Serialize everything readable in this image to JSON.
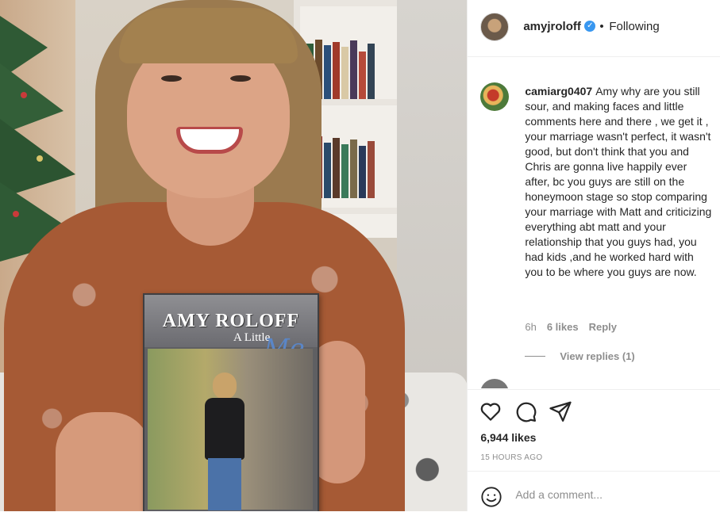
{
  "post": {
    "book_cover": {
      "title": "AMY ROLOFF",
      "subtitle": "A Little",
      "script_word": "Me"
    }
  },
  "header": {
    "username": "amyjroloff",
    "separator": "•",
    "follow_status": "Following"
  },
  "comment": {
    "username": "camiarg0407",
    "text": "Amy why are you still sour, and making faces and little comments here and there , we get it , your marriage wasn't perfect, it wasn't good, but don't think that you and Chris are gonna live happily ever after, bc you guys are still on the honeymoon stage so stop comparing your marriage with Matt and criticizing everything abt matt and your relationship that you guys had, you had kids ,and he worked hard with you to be where you guys are now.",
    "age": "6h",
    "likes": "6 likes",
    "reply_label": "Reply",
    "view_replies": "View replies (1)"
  },
  "actions": {
    "icons": [
      "heart-icon",
      "comment-icon",
      "share-icon"
    ],
    "likes_count": "6,944 likes",
    "timestamp": "15 HOURS AGO"
  },
  "add_comment": {
    "placeholder": "Add a comment..."
  },
  "colors": {
    "verified_blue": "#3897f0",
    "text_primary": "#262626",
    "text_secondary": "#8e8e8e",
    "divider": "#efefef"
  }
}
